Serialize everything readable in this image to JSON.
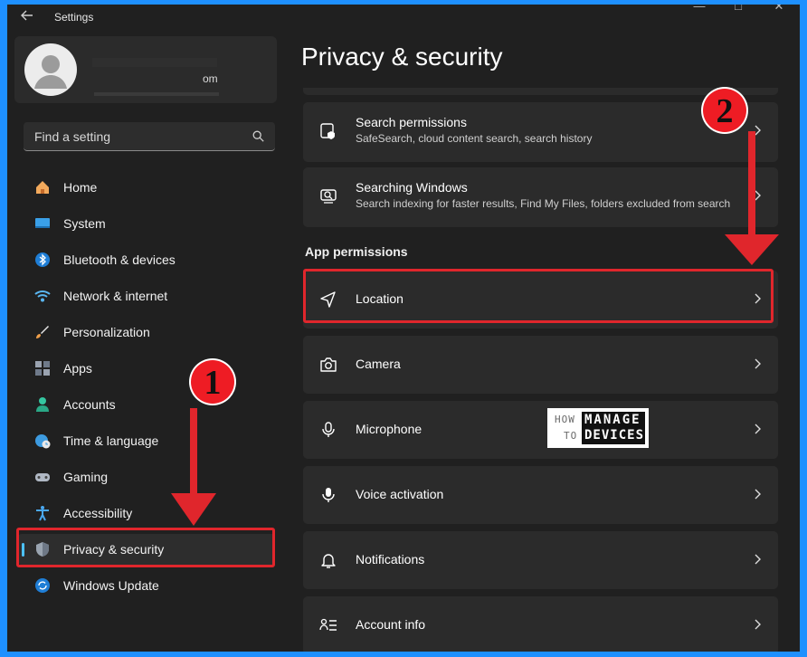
{
  "window": {
    "title": "Settings"
  },
  "profile": {
    "email_fragment": "om"
  },
  "search": {
    "placeholder": "Find a setting"
  },
  "sidebar": {
    "items": [
      {
        "label": "Home",
        "icon": "home-icon"
      },
      {
        "label": "System",
        "icon": "system-icon"
      },
      {
        "label": "Bluetooth & devices",
        "icon": "bluetooth-icon"
      },
      {
        "label": "Network & internet",
        "icon": "network-icon"
      },
      {
        "label": "Personalization",
        "icon": "brush-icon"
      },
      {
        "label": "Apps",
        "icon": "apps-icon"
      },
      {
        "label": "Accounts",
        "icon": "accounts-icon"
      },
      {
        "label": "Time & language",
        "icon": "globe-clock-icon"
      },
      {
        "label": "Gaming",
        "icon": "gamepad-icon"
      },
      {
        "label": "Accessibility",
        "icon": "accessibility-icon"
      },
      {
        "label": "Privacy & security",
        "icon": "shield-icon",
        "selected": true
      },
      {
        "label": "Windows Update",
        "icon": "update-icon"
      }
    ]
  },
  "main": {
    "title": "Privacy & security",
    "cards": [
      {
        "title": "Search permissions",
        "subtitle": "SafeSearch, cloud content search, search history",
        "icon": "search-permissions-icon"
      },
      {
        "title": "Searching Windows",
        "subtitle": "Search indexing for faster results, Find My Files, folders excluded from search",
        "icon": "searching-windows-icon"
      }
    ],
    "section_header": "App permissions",
    "permissions": [
      {
        "title": "Location",
        "icon": "location-icon"
      },
      {
        "title": "Camera",
        "icon": "camera-icon"
      },
      {
        "title": "Microphone",
        "icon": "microphone-icon"
      },
      {
        "title": "Voice activation",
        "icon": "voice-activation-icon"
      },
      {
        "title": "Notifications",
        "icon": "bell-icon"
      },
      {
        "title": "Account info",
        "icon": "account-info-icon"
      }
    ]
  },
  "annotations": {
    "step1": "1",
    "step2": "2",
    "highlight_color": "#e0262c",
    "badge_color": "#ee1c24"
  },
  "watermark": {
    "line1": "HOW",
    "line2": "TO",
    "box1": "MANAGE",
    "box2": "DEVICES"
  },
  "colors": {
    "accent": "#4cc2ff",
    "background": "#202020",
    "card": "#2b2b2b",
    "frame": "#1e90ff"
  }
}
